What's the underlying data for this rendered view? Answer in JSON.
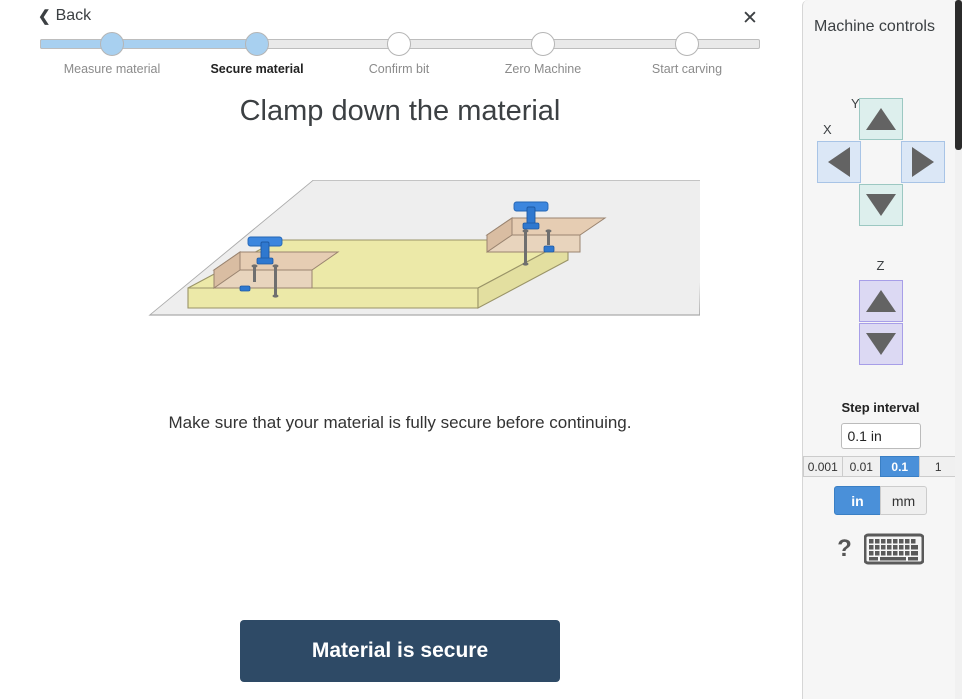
{
  "nav": {
    "back_label": "Back",
    "back_icon": "chevron-left-icon",
    "close_icon": "close-icon",
    "close_glyph": "✕"
  },
  "stepper": {
    "current_index": 1,
    "steps": [
      {
        "label": "Measure material",
        "state": "done"
      },
      {
        "label": "Secure material",
        "state": "current"
      },
      {
        "label": "Confirm bit",
        "state": "todo"
      },
      {
        "label": "Zero Machine",
        "state": "todo"
      },
      {
        "label": "Start carving",
        "state": "todo"
      }
    ],
    "fill_color": "#a8d0f0",
    "track_color": "#e9e9e9"
  },
  "main": {
    "headline": "Clamp down the material",
    "body": "Make sure that your material is fully secure before continuing.",
    "illustration_name": "cnc-bed-with-clamped-material-illustration",
    "cta_label": "Material is secure",
    "cta_color": "#2e4a66"
  },
  "controls": {
    "title": "Machine controls",
    "axes": {
      "xy": {
        "x_label": "X",
        "y_label": "Y",
        "buttons": [
          {
            "name": "jog-y-plus-button",
            "dir": "up",
            "axis": "y"
          },
          {
            "name": "jog-x-minus-button",
            "dir": "left",
            "axis": "x"
          },
          {
            "name": "jog-x-plus-button",
            "dir": "right",
            "axis": "x"
          },
          {
            "name": "jog-y-minus-button",
            "dir": "down",
            "axis": "y"
          }
        ],
        "y_color": "#ddefed",
        "x_color": "#dbe7f6"
      },
      "z": {
        "label": "Z",
        "buttons": [
          {
            "name": "jog-z-plus-button",
            "dir": "up"
          },
          {
            "name": "jog-z-minus-button",
            "dir": "down"
          }
        ],
        "color": "#dcd9f3"
      }
    },
    "step": {
      "title": "Step interval",
      "input_value": "0.1 in",
      "input_placeholder": "0.1 in",
      "presets": [
        "0.001",
        "0.01",
        "0.1",
        "1"
      ],
      "active_preset": "0.1"
    },
    "units": {
      "options": [
        "in",
        "mm"
      ],
      "active": "in"
    },
    "shortcuts": {
      "help_glyph": "?",
      "help_icon": "question-mark-icon",
      "keyboard_icon": "keyboard-icon"
    },
    "accent_color": "#4a90d9"
  }
}
